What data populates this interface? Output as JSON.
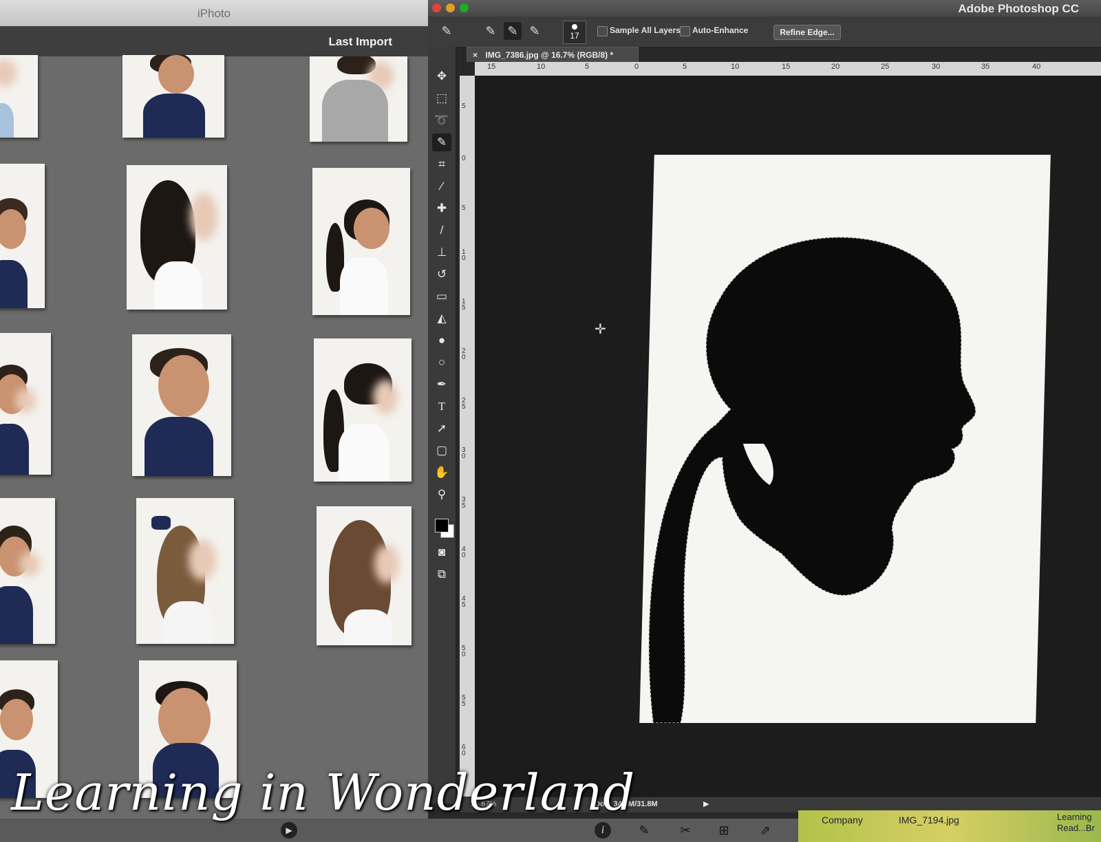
{
  "iphoto": {
    "window_title": "iPhoto",
    "section_title": "Last Import"
  },
  "photoshop": {
    "window_title": "Adobe Photoshop CC",
    "options": {
      "brush_size": "17",
      "sample_all_layers": "Sample All Layers",
      "auto_enhance": "Auto-Enhance",
      "refine_edge": "Refine Edge..."
    },
    "document_tab": "IMG_7386.jpg @ 16.7% (RGB/8) *",
    "ruler_top_labels": [
      "15",
      "10",
      "5",
      "0",
      "5",
      "10",
      "15",
      "20",
      "25",
      "30",
      "35",
      "40"
    ],
    "ruler_left_labels": [
      "5",
      "0",
      "5",
      "1 0",
      "1 5",
      "2 0",
      "2 5",
      "3 0",
      "3 5",
      "4 0",
      "4 5",
      "5 0",
      "5 5",
      "6 0"
    ],
    "status": {
      "zoom": "16.67%",
      "doc_size": "Doc: 34.8M/31.8M"
    }
  },
  "bottom_panel": {
    "col1": "Company",
    "col2": "IMG_7194.jpg",
    "col3": "Learning Read...Br"
  },
  "watermark": "Learning in Wonderland",
  "colors": {
    "iphoto_bg": "#6b6b6b",
    "photoshop_bg": "#282828",
    "uniform_navy": "#1f2b55"
  },
  "icons": [
    "play-icon",
    "info-icon",
    "pencil-icon",
    "scissors-icon",
    "add-icon",
    "share-icon"
  ]
}
